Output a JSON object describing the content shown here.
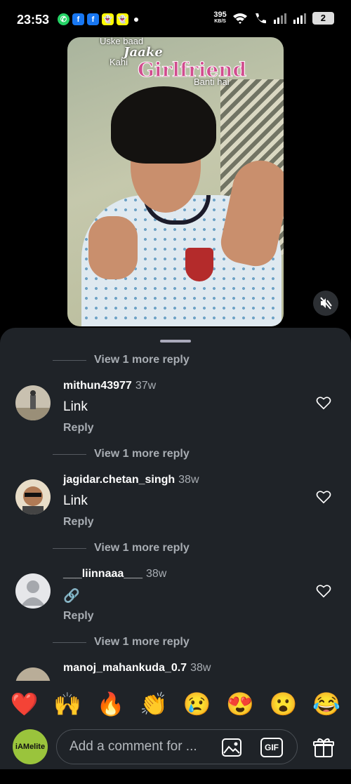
{
  "status": {
    "time": "23:53",
    "net_speed": "395",
    "net_unit": "KB/S",
    "battery": "2",
    "notif_icons": [
      "whatsapp-icon",
      "facebook-icon",
      "facebook-icon",
      "snapchat-icon",
      "snapchat-icon"
    ]
  },
  "video": {
    "caption_line1": "Uske baad",
    "caption_line2": "Jaake",
    "caption_line3": "Kahi",
    "caption_line4": "Girlfriend",
    "caption_line5": "Banti hai"
  },
  "comments": {
    "view_more_label": "View 1 more reply",
    "items": [
      {
        "username": "mithun43977",
        "age": "37w",
        "text": "Link",
        "reply": "Reply"
      },
      {
        "username": "jagidar.chetan_singh",
        "age": "38w",
        "text": "Link",
        "reply": "Reply"
      },
      {
        "username": "___liinnaaa___",
        "age": "38w",
        "text": "🔗",
        "reply": "Reply"
      },
      {
        "username": "manoj_mahankuda_0.7",
        "age": "38w",
        "text": "",
        "reply": ""
      }
    ]
  },
  "emojis": [
    "❤️",
    "🙌",
    "🔥",
    "👏",
    "😢",
    "😍",
    "😮",
    "😂"
  ],
  "composer": {
    "avatar_text": "iAMelite",
    "placeholder": "Add a comment for ...",
    "gif_label": "GIF"
  }
}
